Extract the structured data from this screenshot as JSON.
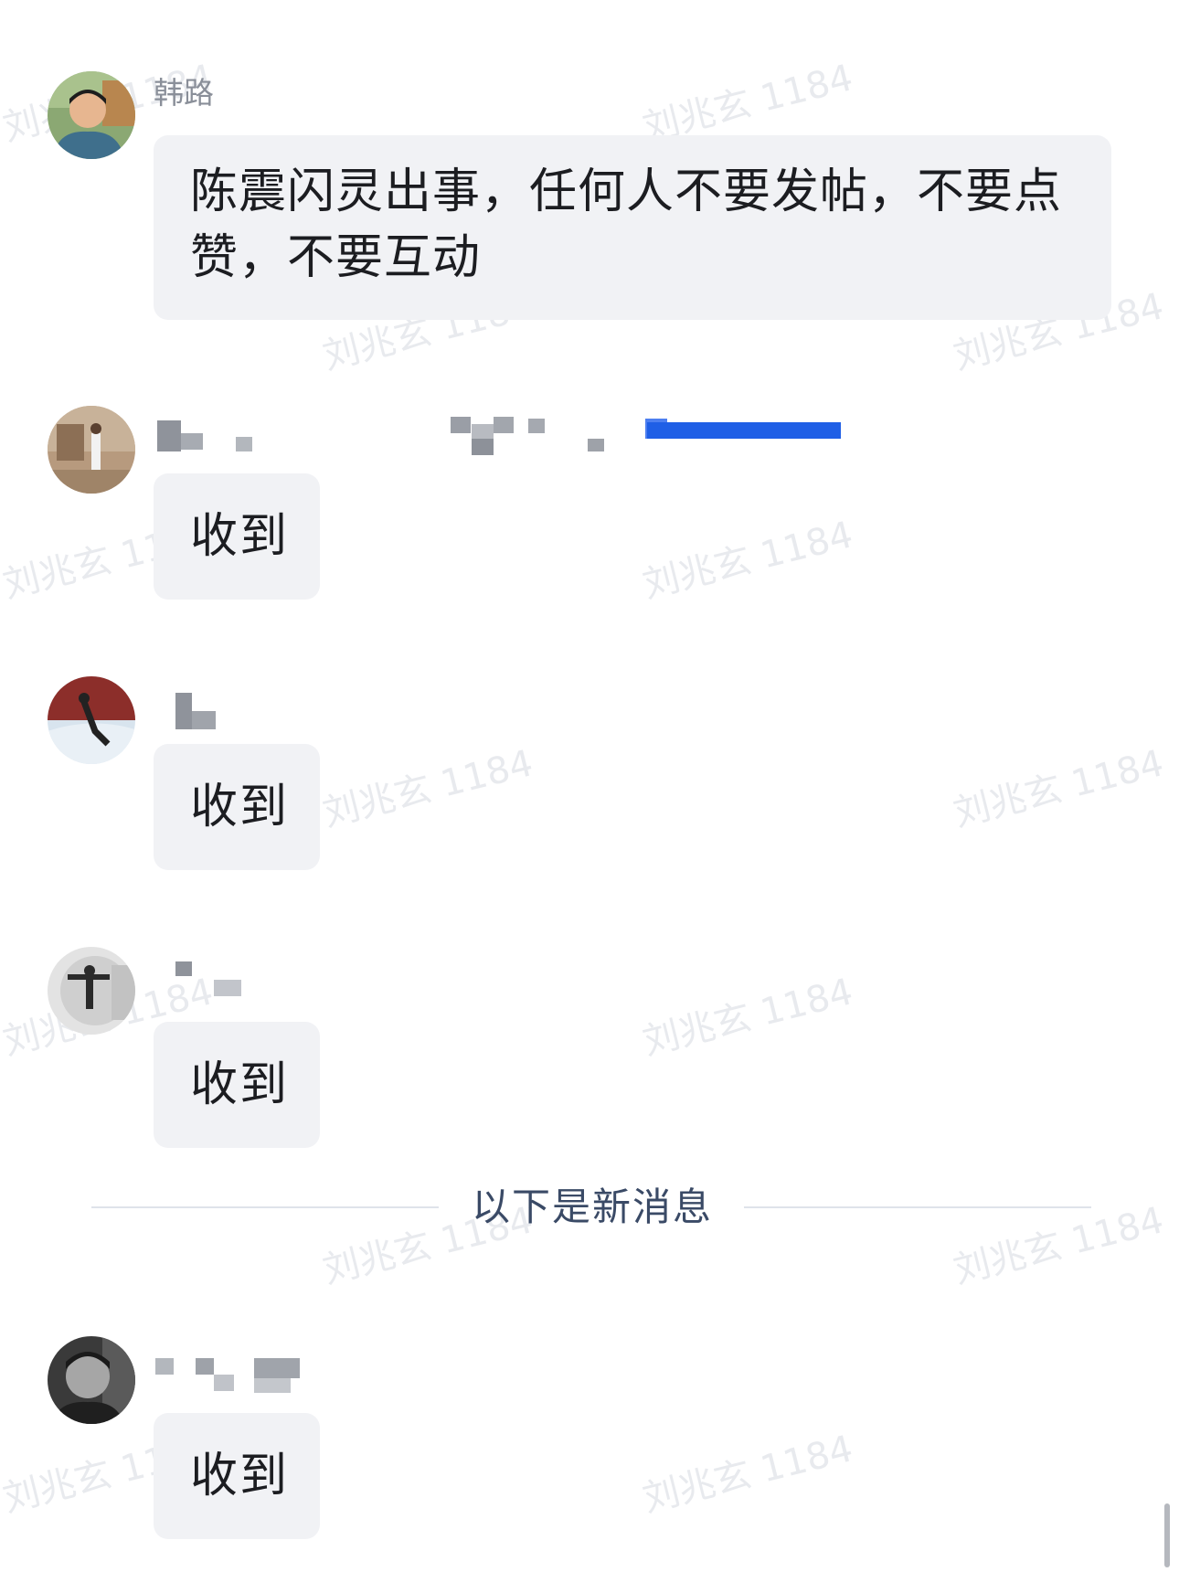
{
  "messages": [
    {
      "sender": "韩路",
      "text": "陈震闪灵出事，任何人不要发帖，不要点赞，不要互动"
    },
    {
      "sender": "",
      "text": "收到"
    },
    {
      "sender": "",
      "text": "收到"
    },
    {
      "sender": "",
      "text": "收到"
    },
    {
      "sender": "",
      "text": "收到"
    }
  ],
  "divider": {
    "label": "以下是新消息"
  },
  "watermark": {
    "text": "刘兆玄 1184"
  },
  "colors": {
    "bubble_bg": "#f1f2f5",
    "sender_name": "#8a8f99",
    "divider_text": "#3a4a66",
    "redaction_blue": "#1f5fe6"
  }
}
